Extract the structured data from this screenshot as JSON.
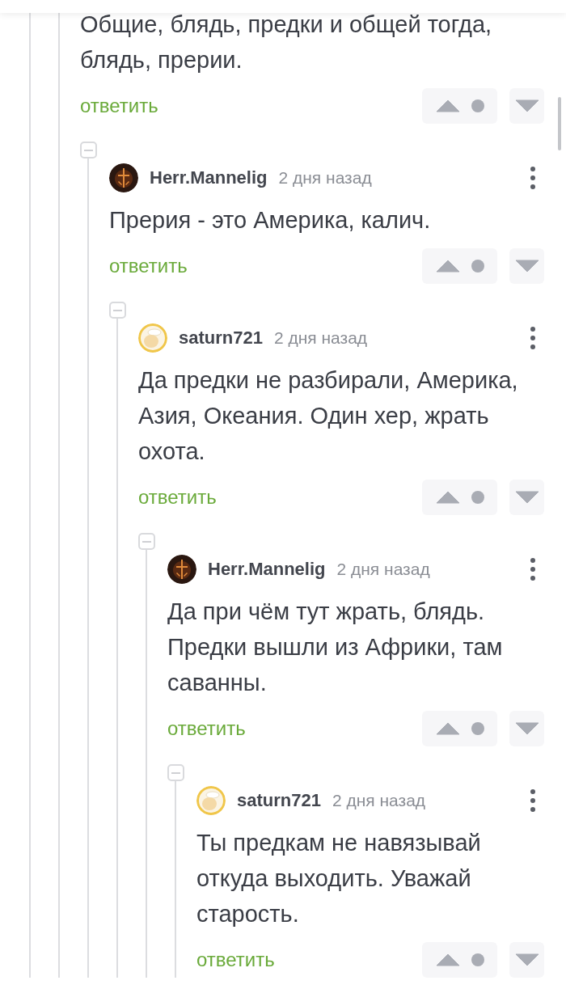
{
  "thread": {
    "text": "Общие, блядь, предки и общей тогда, блядь, прерии.",
    "reply": "ответить",
    "children": [
      {
        "author": "Herr.Mannelig",
        "time": "2 дня назад",
        "text": "Прерия - это Америка, калич.",
        "reply": "ответить",
        "children": [
          {
            "author": "saturn721",
            "time": "2 дня назад",
            "text": "Да предки не разбирали, Америка, Азия, Океания. Один хер, жрать охота.",
            "reply": "ответить",
            "children": [
              {
                "author": "Herr.Mannelig",
                "time": "2 дня назад",
                "text": "Да при чём тут жрать, блядь. Предки вышли из Африки, там саванны.",
                "reply": "ответить",
                "children": [
                  {
                    "author": "saturn721",
                    "time": "2 дня назад",
                    "text": "Ты предкам не навязывай откуда выходить. Уважай старость.",
                    "reply": "ответить"
                  }
                ]
              }
            ]
          }
        ]
      }
    ]
  }
}
